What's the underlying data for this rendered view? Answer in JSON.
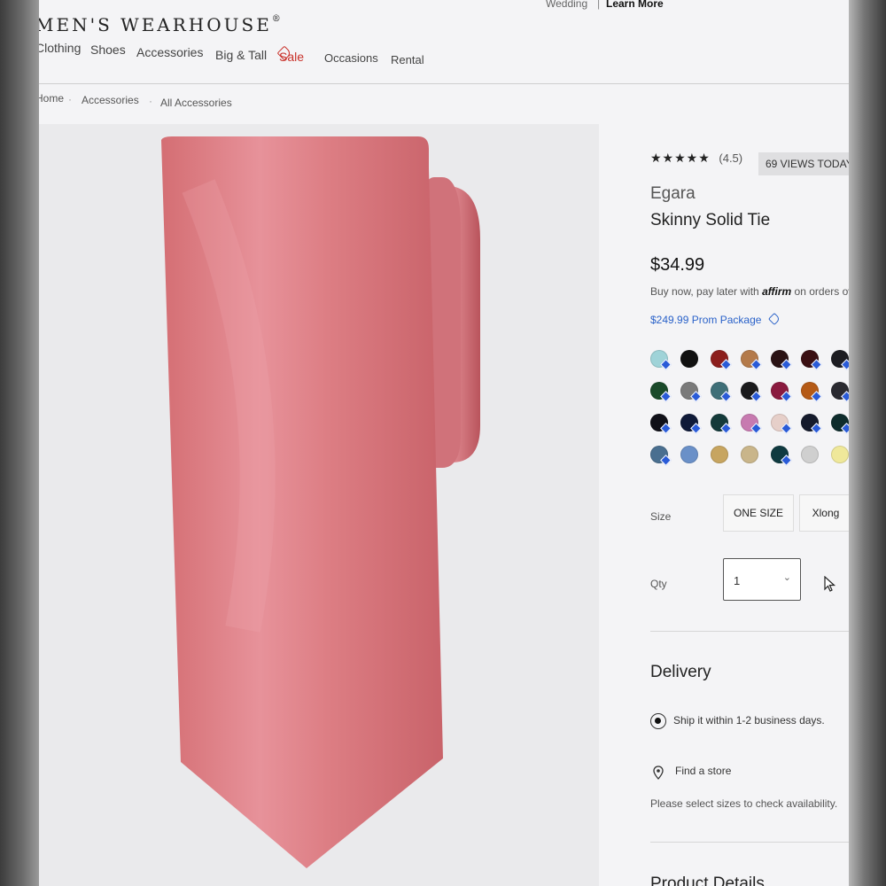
{
  "topbar": {
    "promo_text": "Wedding",
    "separator": "|",
    "learn_more": "Learn More"
  },
  "logo": {
    "text": "MEN'S WEARHOUSE",
    "mark": "®"
  },
  "nav": {
    "clothing": "Clothing",
    "shoes": "Shoes",
    "accessories": "Accessories",
    "big_tall": "Big & Tall",
    "sale": "Sale",
    "occasions": "Occasions",
    "rental": "Rental"
  },
  "breadcrumb": {
    "home": "Home",
    "sep": "·",
    "accessories": "Accessories",
    "all_accessories": "All Accessories"
  },
  "product": {
    "stars": "★★★★★",
    "rating": "(4.5)",
    "views": "69 VIEWS TODAY",
    "brand": "Egara",
    "name": "Skinny Solid Tie",
    "price": "$34.99",
    "affirm_prefix": "Buy now, pay later with",
    "affirm_logo": "affirm",
    "affirm_suffix": "on orders ov",
    "prom_package": "$249.99 Prom Package",
    "image_color": "#d9767a"
  },
  "swatches": [
    [
      "#9fd3d8",
      "#111111",
      "#8c1e1c",
      "#b47a4a",
      "#2a1214",
      "#3a0f12",
      "#1d1d22"
    ],
    [
      "#1a4a2a",
      "#7a7a7a",
      "#3f6f78",
      "#1a1a1c",
      "#8a1a3f",
      "#b55a16",
      "#2a2a30"
    ],
    [
      "#101018",
      "#0f1a38",
      "#143a3a",
      "#c77ab0",
      "#e6cfc9",
      "#151b2c",
      "#0e2c2c"
    ],
    [
      "#4a6f90",
      "#6a90c8",
      "#c7a560",
      "#c9b58a",
      "#0f3a40",
      "#cfcfcf",
      "#efe89a"
    ]
  ],
  "size": {
    "label": "Size",
    "options": [
      "ONE SIZE",
      "Xlong"
    ]
  },
  "qty": {
    "label": "Qty",
    "value": "1"
  },
  "delivery": {
    "title": "Delivery",
    "ship_option": "Ship it within 1-2 business days.",
    "find_store": "Find a store",
    "note": "Please select sizes to check availability."
  },
  "details": {
    "title": "Product Details"
  }
}
